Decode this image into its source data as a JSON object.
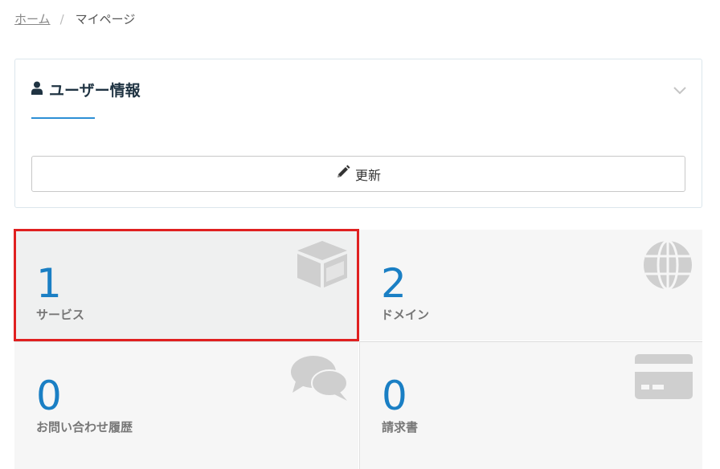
{
  "breadcrumb": {
    "home": "ホーム",
    "separator": "/",
    "current": "マイページ"
  },
  "user_panel": {
    "title": "ユーザー情報",
    "icon": "user-icon",
    "update_button_label": "更新",
    "update_icon": "pencil-icon",
    "collapse_icon": "chevron-down-icon"
  },
  "tiles": [
    {
      "count": "1",
      "label": "サービス",
      "icon": "box-icon",
      "highlighted": true
    },
    {
      "count": "2",
      "label": "ドメイン",
      "icon": "globe-icon",
      "highlighted": false
    },
    {
      "count": "0",
      "label": "お問い合わせ履歴",
      "icon": "chat-bubbles-icon",
      "highlighted": false
    },
    {
      "count": "0",
      "label": "請求書",
      "icon": "credit-card-icon",
      "highlighted": false
    }
  ],
  "colors": {
    "accent": "#2d8fd5",
    "count": "#1a7fc4",
    "highlight": "#e02020",
    "tile_bg": "#f6f6f6"
  }
}
